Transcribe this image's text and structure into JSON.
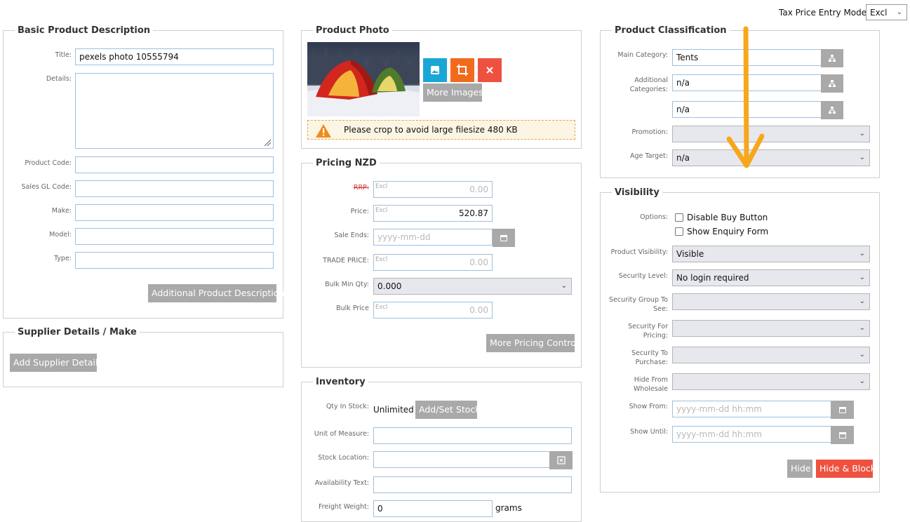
{
  "tax_mode": {
    "label": "Tax Price Entry Mode:",
    "value": "Excl"
  },
  "basic": {
    "title": "Basic Product Description",
    "title_label": "Title:",
    "title_value": "pexels photo 10555794",
    "details_label": "Details:",
    "product_code_label": "Product Code:",
    "sales_gl_label": "Sales GL Code:",
    "make_label": "Make:",
    "model_label": "Model:",
    "type_label": "Type:",
    "additional_button": "Additional Product Description"
  },
  "supplier": {
    "title": "Supplier Details / Make",
    "add_button": "Add Supplier Details"
  },
  "photo": {
    "title": "Product Photo",
    "more_images": "More Images",
    "warning": "Please crop to avoid large filesize 480 KB"
  },
  "pricing": {
    "title": "Pricing NZD",
    "rrp_label": "RRP:",
    "rrp_value": "0.00",
    "excl_tag": "Excl",
    "price_label": "Price:",
    "price_value": "520.87",
    "sale_ends_label": "Sale Ends:",
    "sale_ends_placeholder": "yyyy-mm-dd",
    "trade_label": "TRADE PRICE:",
    "trade_value": "0.00",
    "bulk_min_label": "Bulk Min Qty:",
    "bulk_min_value": "0.000",
    "bulk_price_label": "Bulk Price",
    "bulk_price_value": "0.00",
    "more_button": "More Pricing Control"
  },
  "inventory": {
    "title": "Inventory",
    "qty_label": "Qty In Stock:",
    "qty_value": "Unlimited",
    "add_stock_button": "Add/Set Stock",
    "uom_label": "Unit of Measure:",
    "location_label": "Stock Location:",
    "availability_label": "Availability Text:",
    "freight_label": "Freight Weight:",
    "freight_value": "0",
    "freight_unit": "grams"
  },
  "classification": {
    "title": "Product Classification",
    "main_label": "Main Category:",
    "main_value": "Tents",
    "additional_label_1": "Additional",
    "additional_label_2": "Categories:",
    "additional_value_1": "n/a",
    "additional_value_2": "n/a",
    "promotion_label": "Promotion:",
    "age_label": "Age Target:",
    "age_value": "n/a"
  },
  "visibility": {
    "title": "Visibility",
    "options_label": "Options:",
    "disable_buy": "Disable Buy Button",
    "show_enquiry": "Show Enquiry Form",
    "product_vis_label": "Product Visibility:",
    "product_vis_value": "Visible",
    "security_level_label": "Security Level:",
    "security_level_value": "No login required",
    "security_group_label_1": "Security Group To",
    "security_group_label_2": "See:",
    "security_pricing_label_1": "Security For",
    "security_pricing_label_2": "Pricing:",
    "security_purchase_label_1": "Security To",
    "security_purchase_label_2": "Purchase:",
    "hide_wholesale_label_1": "Hide From",
    "hide_wholesale_label_2": "Wholesale",
    "show_from_label": "Show From:",
    "show_until_label": "Show Until:",
    "datetime_placeholder": "yyyy-mm-dd hh:mm",
    "hide_button": "Hide",
    "hide_block_button": "Hide & Block"
  },
  "colors": {
    "accent_blue": "#1aa7d6",
    "accent_orange": "#f26b1d",
    "accent_red": "#ef5140",
    "annotation_arrow": "#f7a71b"
  },
  "icons": [
    "image-icon",
    "crop-icon",
    "close-icon",
    "calendar-icon",
    "tree-icon",
    "barcode-icon",
    "warning-icon",
    "chevron-down-icon"
  ]
}
